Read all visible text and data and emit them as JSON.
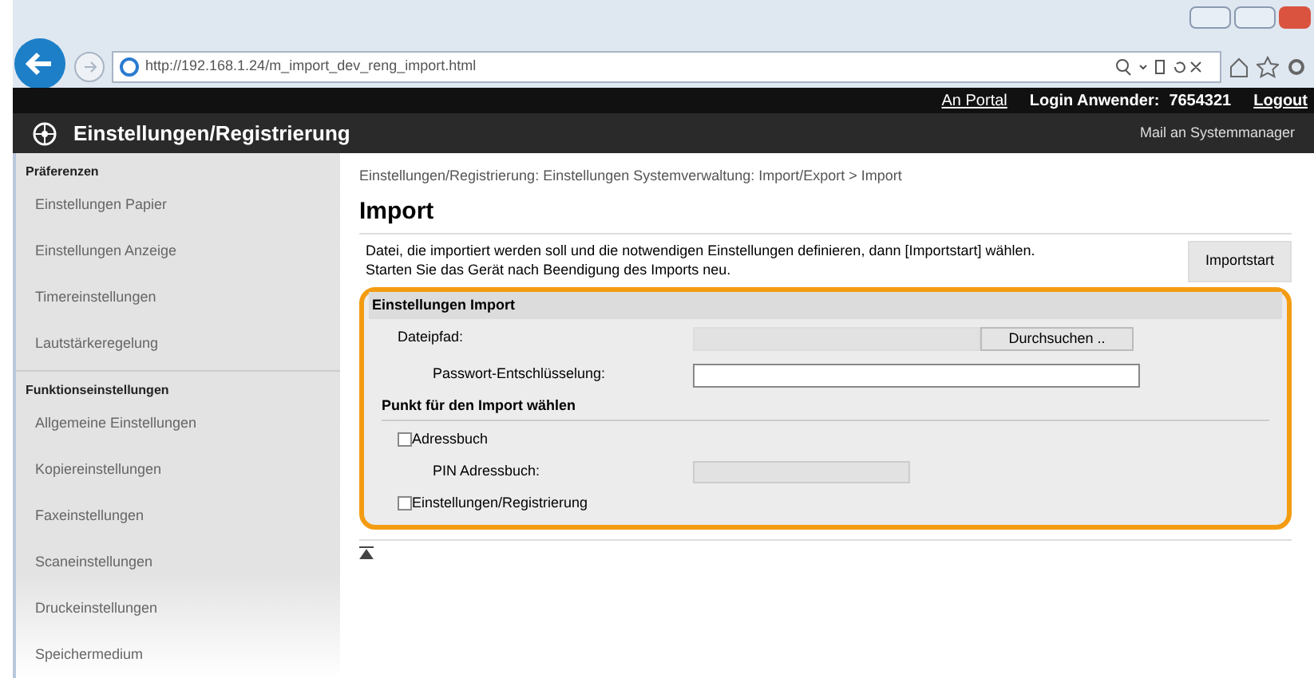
{
  "browser": {
    "url": "http://192.168.1.24/m_import_dev_reng_import.html"
  },
  "top_bar": {
    "links": [
      "An Portal",
      "Logout"
    ],
    "login_label": "Login Anwender:",
    "login_user": "7654321"
  },
  "header": {
    "title": "Einstellungen/Registrierung",
    "mail_link": "Mail an Systemmanager"
  },
  "sidebar": {
    "sections": [
      {
        "heading": "Präferenzen",
        "items": [
          "Einstellungen Papier",
          "Einstellungen Anzeige",
          "Timereinstellungen",
          "Lautstärkeregelung"
        ]
      },
      {
        "heading": "Funktionseinstellungen",
        "items": [
          "Allgemeine Einstellungen",
          "Kopiereinstellungen",
          "Faxeinstellungen",
          "Scaneinstellungen",
          "Druckeinstellungen",
          "Speichermedium"
        ]
      }
    ]
  },
  "breadcrumb": "Einstellungen/Registrierung: Einstellungen Systemverwaltung: Import/Export > Import",
  "page_title": "Import",
  "description": [
    "Datei, die importiert werden soll und die notwendigen Einstellungen definieren, dann [Importstart] wählen.",
    "Starten Sie das Gerät nach Beendigung des Imports neu."
  ],
  "start_button": "Importstart",
  "panel": {
    "title": "Einstellungen Import",
    "file_path": {
      "label": "Dateipfad:",
      "disabled": true,
      "browse_button": "Durchsuchen .."
    },
    "password": {
      "label": "Passwort-Entschlüsselung:",
      "disabled": false
    },
    "subheading": "Punkt für den Import wählen",
    "options": [
      {
        "kind": "checkbox",
        "label": "Adressbuch",
        "checked": false
      },
      {
        "kind": "field",
        "label": "PIN Adressbuch:",
        "disabled": true
      },
      {
        "kind": "checkbox",
        "label": "Einstellungen/Registrierung",
        "checked": false
      }
    ]
  }
}
